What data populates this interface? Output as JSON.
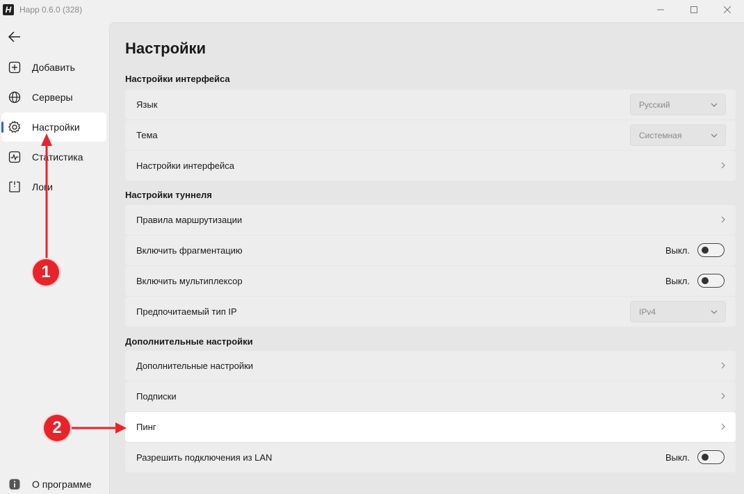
{
  "window": {
    "title": "Happ 0.6.0 (328)"
  },
  "sidebar": {
    "items": [
      {
        "label": "Добавить",
        "icon": "plus-square-icon"
      },
      {
        "label": "Серверы",
        "icon": "globe-icon"
      },
      {
        "label": "Настройки",
        "icon": "gear-icon",
        "active": true
      },
      {
        "label": "Статистика",
        "icon": "chart-icon"
      },
      {
        "label": "Логи",
        "icon": "log-icon"
      }
    ],
    "about": {
      "label": "О программе",
      "icon": "info-icon"
    }
  },
  "main": {
    "title": "Настройки",
    "sections": [
      {
        "title": "Настройки интерфейса",
        "rows": [
          {
            "label": "Язык",
            "dropdown": "Русский"
          },
          {
            "label": "Тема",
            "dropdown": "Системная"
          },
          {
            "label": "Настройки интерфейса"
          }
        ]
      },
      {
        "title": "Настройки туннеля",
        "rows": [
          {
            "label": "Правила маршрутизации"
          },
          {
            "label": "Включить фрагментацию",
            "toggle": "Выкл."
          },
          {
            "label": "Включить мультиплексор",
            "toggle": "Выкл."
          },
          {
            "label": "Предпочитаемый тип IP",
            "dropdown": "IPv4"
          }
        ]
      },
      {
        "title": "Дополнительные настройки",
        "rows": [
          {
            "label": "Дополнительные настройки"
          },
          {
            "label": "Подписки"
          },
          {
            "label": "Пинг",
            "highlighted": true
          },
          {
            "label": "Разрешить подключения из LAN",
            "toggle": "Выкл."
          }
        ]
      }
    ]
  },
  "annotations": {
    "badge1": "1",
    "badge2": "2",
    "color": "#e8242b"
  },
  "colors": {
    "accent": "#3b5bdb",
    "annotation": "#e8242b"
  }
}
